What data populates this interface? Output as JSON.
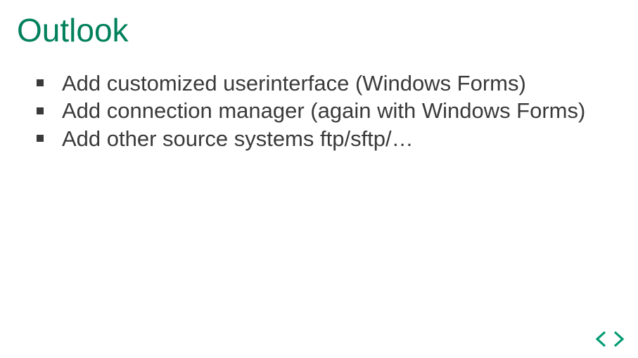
{
  "title": "Outlook",
  "bullets": [
    "Add customized userinterface (Windows Forms)",
    "Add connection manager (again with Windows Forms)",
    "Add other source systems ftp/sftp/…"
  ],
  "colors": {
    "title": "#00805b",
    "text": "#3a3a3a",
    "logo": "#009c73"
  }
}
